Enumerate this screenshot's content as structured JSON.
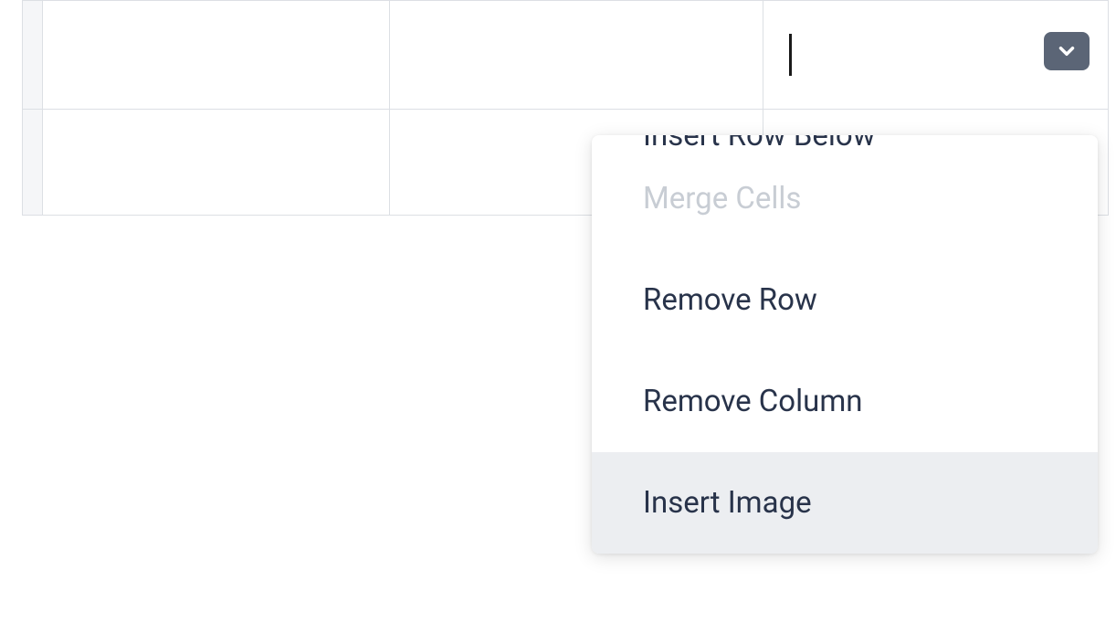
{
  "menu": {
    "items": [
      {
        "label": "Insert Row Below",
        "state": "partial"
      },
      {
        "label": "Merge Cells",
        "state": "disabled"
      },
      {
        "label": "Remove Row",
        "state": "normal"
      },
      {
        "label": "Remove Column",
        "state": "normal"
      },
      {
        "label": "Insert Image",
        "state": "highlighted"
      }
    ]
  }
}
